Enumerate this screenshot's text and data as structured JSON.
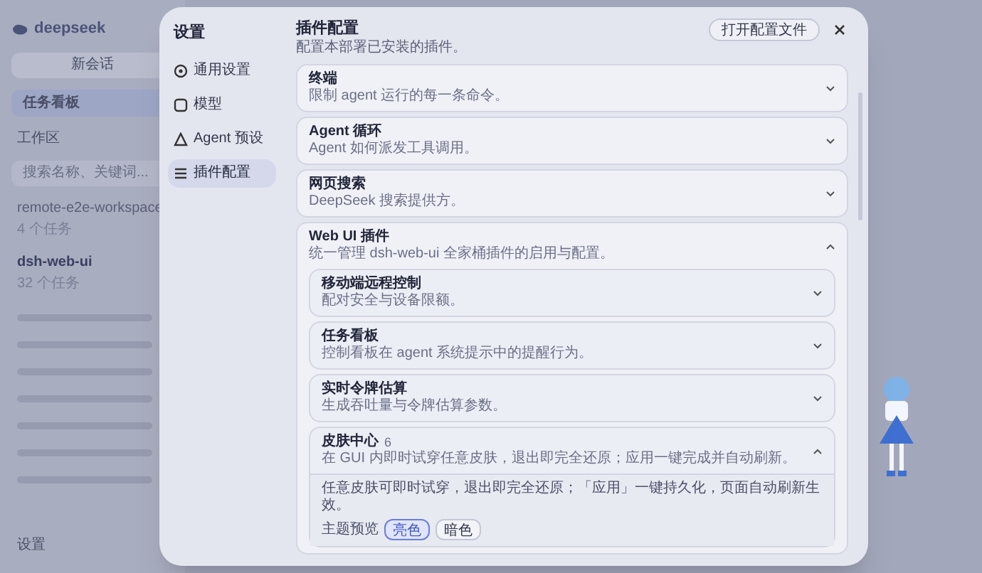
{
  "sidebar": {
    "logo": "deepseek",
    "new_chat": "新会话",
    "nav_item": "任务看板",
    "workspace_label": "工作区",
    "search": {
      "placeholder": "搜索名称、关键词..."
    },
    "workspaces": [
      {
        "name": "remote-e2e-workspace",
        "count": "4 个任务",
        "selected": false
      },
      {
        "name": "dsh-web-ui",
        "count": "32 个任务",
        "selected": true
      }
    ],
    "settings": "设置"
  },
  "dialog": {
    "title": "设置",
    "open_config_button": "打开配置文件",
    "nav": [
      {
        "label": "通用设置",
        "selected": false
      },
      {
        "label": "模型",
        "selected": false
      },
      {
        "label": "Agent 预设",
        "selected": false
      },
      {
        "label": "插件配置",
        "selected": true
      }
    ],
    "heading": "插件配置",
    "subtitle": "配置本部署已安装的插件。",
    "plugins": [
      {
        "title": "终端",
        "description": "限制 agent 运行的每一条命令。",
        "expanded": false
      },
      {
        "title": "Agent 循环",
        "description": "Agent 如何派发工具调用。",
        "expanded": false
      },
      {
        "title": "网页搜索",
        "description": "DeepSeek 搜索提供方。",
        "expanded": false
      },
      {
        "title": "Web UI 插件",
        "description": "统一管理 dsh-web-ui 全家桶插件的启用与配置。",
        "expanded": true,
        "children": [
          {
            "title": "移动端远程控制",
            "description": "配对安全与设备限额。",
            "expanded": false
          },
          {
            "title": "任务看板",
            "description": "控制看板在 agent 系统提示中的提醒行为。",
            "expanded": false
          },
          {
            "title": "实时令牌估算",
            "description": "生成吞吐量与令牌估算参数。",
            "expanded": false
          },
          {
            "title": "皮肤中心",
            "badge": "6",
            "description": "在 GUI 内即时试穿任意皮肤，退出即完全还原；应用一键完成并自动刷新。",
            "expanded": true,
            "body": {
              "text": "任意皮肤可即时试穿，退出即完全还原；「应用」一键持久化，页面自动刷新生效。",
              "preview_label": "主题预览",
              "themes": [
                {
                  "label": "亮色",
                  "selected": true
                },
                {
                  "label": "暗色",
                  "selected": false
                }
              ]
            }
          }
        ]
      }
    ]
  }
}
